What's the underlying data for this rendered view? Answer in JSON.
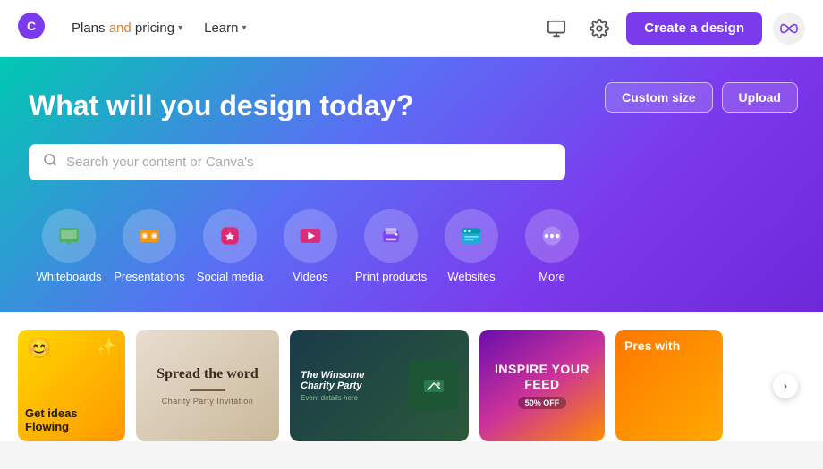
{
  "header": {
    "logo_symbol": "∞",
    "nav": [
      {
        "id": "plans",
        "text_normal": "",
        "text_highlight": "Plans",
        "text_rest": " and pricing",
        "has_chevron": true
      },
      {
        "id": "learn",
        "text": "Learn",
        "has_chevron": true
      }
    ],
    "actions": {
      "monitor_icon": "🖥",
      "settings_icon": "⚙",
      "create_btn": "Create a design",
      "avatar_symbol": "∞"
    }
  },
  "hero": {
    "title": "What will you design today?",
    "search_placeholder": "Search your content or Canva's",
    "custom_size_btn": "Custom size",
    "upload_btn": "Upload",
    "categories": [
      {
        "id": "whiteboards",
        "label": "Whiteboards",
        "emoji": "🟩"
      },
      {
        "id": "presentations",
        "label": "Presentations",
        "emoji": "💬"
      },
      {
        "id": "social-media",
        "label": "Social media",
        "emoji": "❤"
      },
      {
        "id": "videos",
        "label": "Videos",
        "emoji": "▶"
      },
      {
        "id": "print-products",
        "label": "Print products",
        "emoji": "🖨"
      },
      {
        "id": "websites",
        "label": "Websites",
        "emoji": "🌐"
      },
      {
        "id": "more",
        "label": "More",
        "emoji": "···"
      }
    ]
  },
  "templates": {
    "card1": {
      "title": "Get ideas Flowing",
      "emoji_top": "😊",
      "star": "✨"
    },
    "card2": {
      "title": "Spread the word",
      "sub": "Charity Party Invitation"
    },
    "card3": {
      "title": "The Winsome Charity Party",
      "sub": "Event details here"
    },
    "card4": {
      "title": "INSPIRE YOUR FEED",
      "badge": "50% OFF"
    },
    "card5": {
      "title": "Pres with"
    },
    "scroll_arrow": "›"
  },
  "colors": {
    "purple": "#7c3aed",
    "orange": "#e67e22",
    "hero_gradient_start": "#00c9b1",
    "hero_gradient_end": "#6d28d9"
  }
}
